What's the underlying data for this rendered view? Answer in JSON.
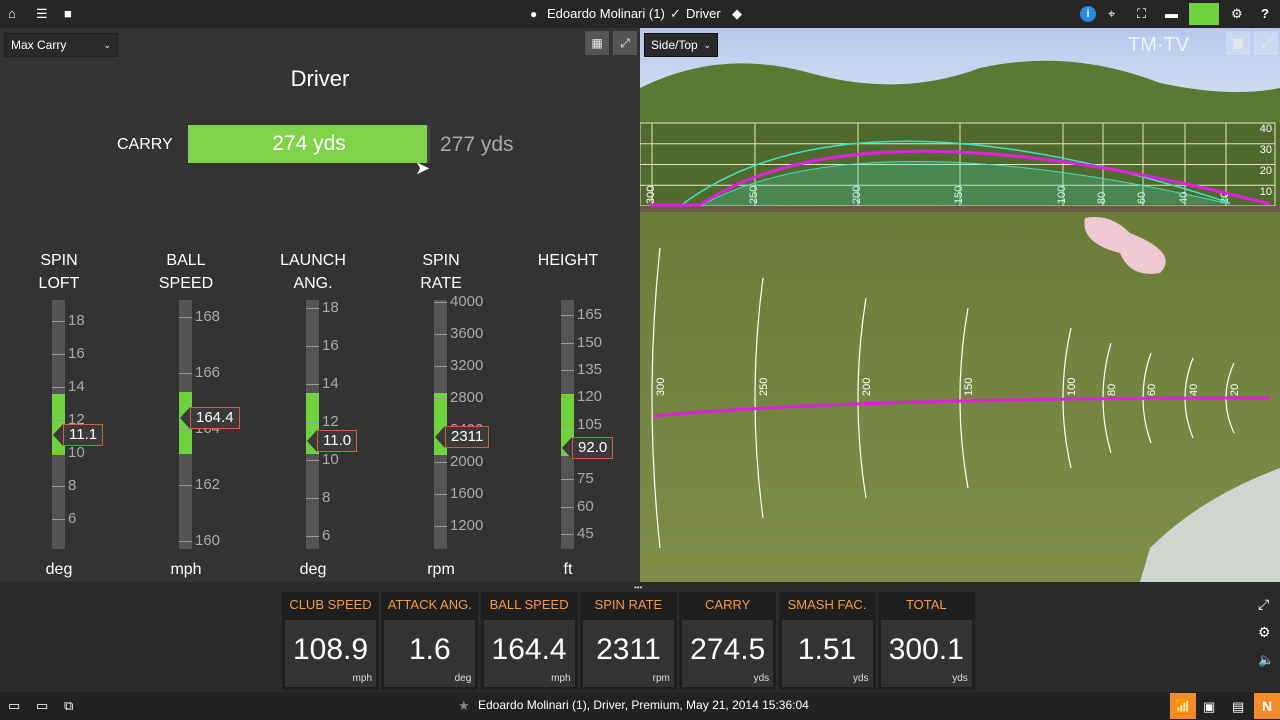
{
  "topbar": {
    "user": "Edoardo Molinari (1)",
    "club": "Driver",
    "icons": [
      "home-icon",
      "list-icon",
      "folder-icon",
      "user-icon",
      "club-icon",
      "tag-icon",
      "info-icon",
      "target-icon",
      "camera-frame-icon",
      "video-icon",
      "device-status-icon",
      "gear-icon",
      "help-icon"
    ]
  },
  "left": {
    "mode_select": "Max Carry",
    "title": "Driver",
    "carry": {
      "label": "CARRY",
      "value": "274 yds",
      "max": "277 yds",
      "fraction": 0.989,
      "color": "#7ed348"
    },
    "gauges": [
      {
        "label1": "SPIN",
        "label2": "LOFT",
        "unit": "deg",
        "value": "11.1",
        "v": 11.1,
        "range": [
          4.2,
          19.3
        ],
        "target": [
          9.9,
          13.6
        ],
        "ticks": [
          18,
          16,
          14,
          12,
          10,
          8,
          6
        ]
      },
      {
        "label1": "BALL",
        "label2": "SPEED",
        "unit": "mph",
        "value": "164.4",
        "v": 164.4,
        "range": [
          159.7,
          168.6
        ],
        "target": [
          163.1,
          165.3
        ],
        "ticks": [
          168,
          166,
          164,
          162,
          160
        ]
      },
      {
        "label1": "LAUNCH",
        "label2": "ANG.",
        "unit": "deg",
        "value": "11.0",
        "v": 11.0,
        "range": [
          5.3,
          18.4
        ],
        "target": [
          10.3,
          13.5
        ],
        "ticks": [
          18,
          16,
          14,
          12,
          10,
          8,
          6
        ]
      },
      {
        "label1": "SPIN",
        "label2": "RATE",
        "unit": "rpm",
        "value": "2311",
        "v": 2311,
        "range": [
          912,
          4025
        ],
        "target": [
          2087,
          2862
        ],
        "ticks": [
          4000,
          3600,
          3200,
          2800,
          2400,
          2000,
          1600,
          1200
        ]
      },
      {
        "label1": "HEIGHT",
        "label2": "",
        "unit": "ft",
        "value": "92.0",
        "v": 92,
        "range": [
          36.7,
          173.5
        ],
        "target": [
          88,
          122
        ],
        "ticks": [
          165,
          150,
          135,
          120,
          105,
          90,
          75,
          60,
          45
        ]
      }
    ]
  },
  "view": {
    "mode_select": "Side/Top",
    "watermark": "TM·TV",
    "side_heights": [
      "40",
      "30",
      "20",
      "10"
    ],
    "distances": [
      "300",
      "250",
      "200",
      "150",
      "100",
      "80",
      "60",
      "40",
      "20"
    ],
    "trajectory_color": "#e020e0",
    "band_color": "#40e0c0"
  },
  "metrics": [
    {
      "label": "CLUB SPEED",
      "value": "108.9",
      "unit": "mph"
    },
    {
      "label": "ATTACK ANG.",
      "value": "1.6",
      "unit": "deg"
    },
    {
      "label": "BALL SPEED",
      "value": "164.4",
      "unit": "mph"
    },
    {
      "label": "SPIN RATE",
      "value": "2311",
      "unit": "rpm"
    },
    {
      "label": "CARRY",
      "value": "274.5",
      "unit": "yds"
    },
    {
      "label": "SMASH FAC.",
      "value": "1.51",
      "unit": "yds"
    },
    {
      "label": "TOTAL",
      "value": "300.1",
      "unit": "yds"
    }
  ],
  "status": {
    "text": "Edoardo Molinari (1), Driver, Premium, May 21, 2014 15:36:04",
    "n_label": "N"
  }
}
